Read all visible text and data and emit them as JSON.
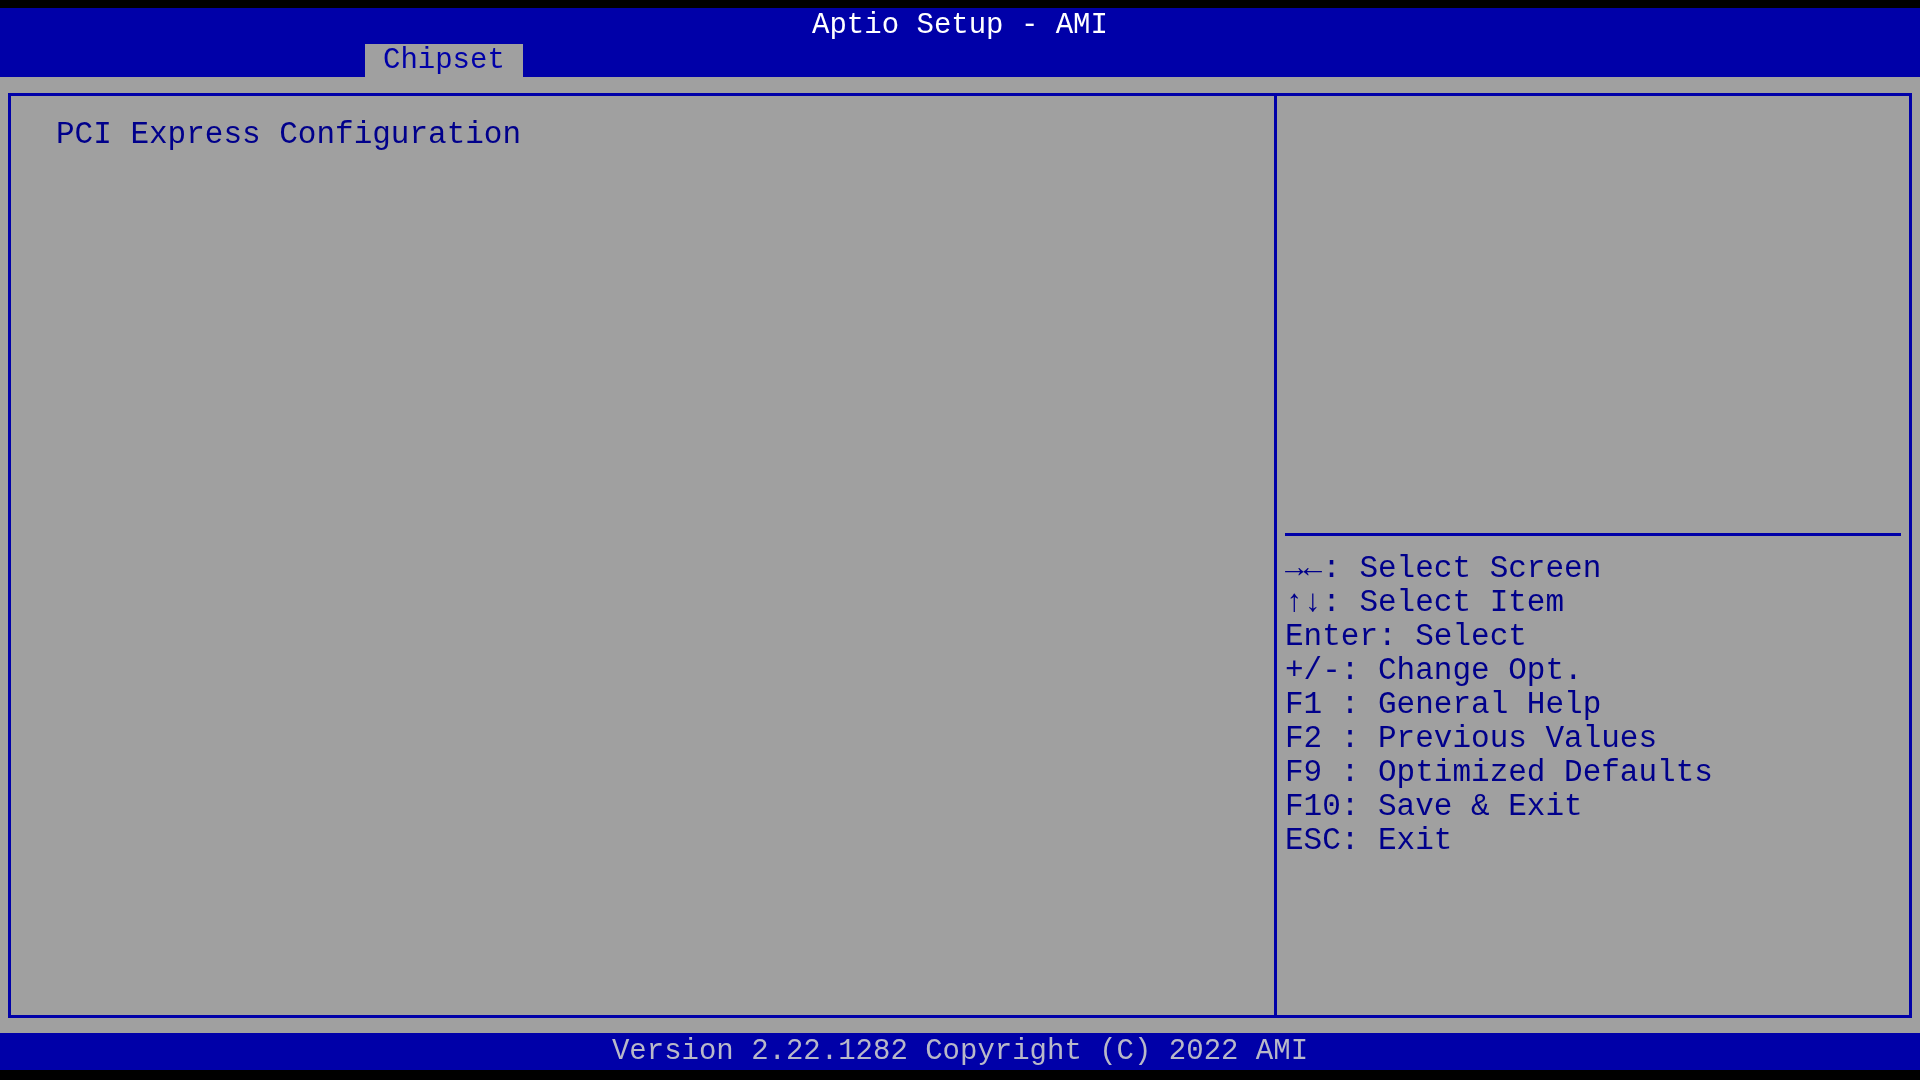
{
  "window": {
    "title": "Aptio Setup - AMI"
  },
  "tabs": [
    {
      "label": "Chipset",
      "selected": true
    }
  ],
  "menu": {
    "items": [
      {
        "label": "PCI Express Configuration"
      }
    ]
  },
  "help": {
    "keys": [
      "→←: Select Screen",
      "↑↓: Select Item",
      "Enter: Select",
      "+/-: Change Opt.",
      "F1 : General Help",
      "F2 : Previous Values",
      "F9 : Optimized Defaults",
      "F10: Save & Exit",
      "ESC: Exit"
    ]
  },
  "status_bar": "Version 2.22.1282 Copyright (C) 2022 AMI"
}
